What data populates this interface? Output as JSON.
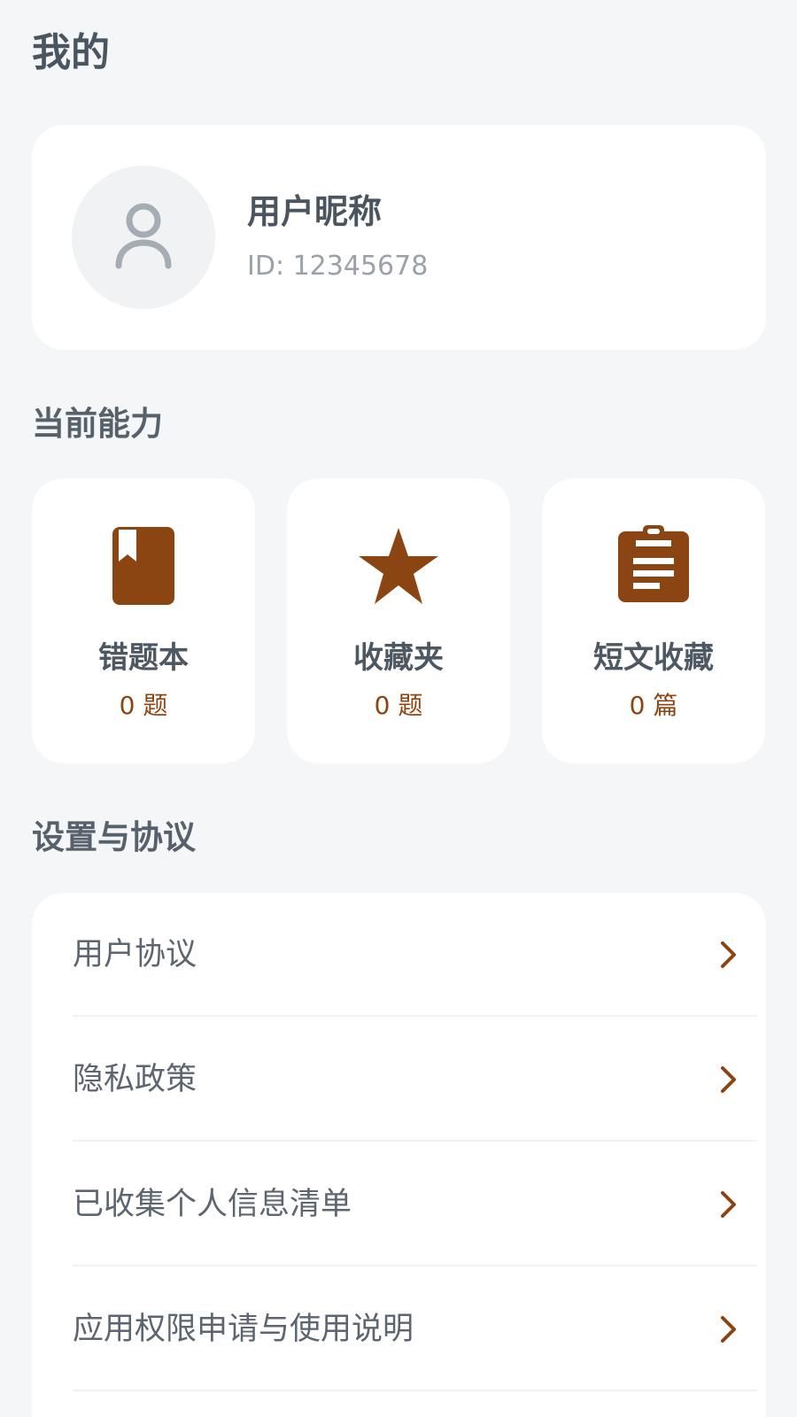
{
  "page": {
    "title": "我的"
  },
  "profile": {
    "nickname": "用户昵称",
    "id_text": "ID: 12345678",
    "avatar_icon": "user-icon"
  },
  "abilities": {
    "title": "当前能力",
    "items": [
      {
        "label": "错题本",
        "count": "0 题",
        "icon": "bookmark-book-icon"
      },
      {
        "label": "收藏夹",
        "count": "0 题",
        "icon": "star-icon"
      },
      {
        "label": "短文收藏",
        "count": "0 篇",
        "icon": "clipboard-icon"
      }
    ]
  },
  "settings": {
    "title": "设置与协议",
    "items": [
      {
        "label": "用户协议"
      },
      {
        "label": "隐私政策"
      },
      {
        "label": "已收集个人信息清单"
      },
      {
        "label": "应用权限申请与使用说明"
      }
    ]
  },
  "colors": {
    "accent": "#8b4513",
    "background": "#f5f6f7",
    "card": "#ffffff",
    "text_primary": "#4a5560",
    "text_secondary": "#9aa1a8"
  }
}
